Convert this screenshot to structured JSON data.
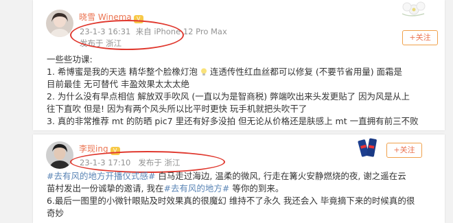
{
  "post1": {
    "username": "晓雪 Winema",
    "badge_icon": "vip-badge-icon",
    "date": "23-1-3 16:31",
    "device": "来自 iPhone 12 Pro Max",
    "location": "发布于 浙江",
    "follow_label": "+关注",
    "lines": [
      "一些些功课:",
      "1. 希博蜜是我的天选 精华整个脸橡灯泡",
      "连透传性红血丝都可以修复 (不要节省用量)  面霜是",
      "目前最佳 无可替代 丰盈效果太太太绝",
      "2. 为什么没有早点相信 解放双手吹风 (一直以为是智商税) 弊端吹出来头发更贴了 因为风是从上",
      "往下直吹 但是! 因为有两个风头所以比平时更快 玩手机就把头吹干了",
      "3. 真的非常推荐 mt 的防晒 pic7 里还有好多没拍 但无论从价格还是肤感上 mt 一直拥有前三不败"
    ]
  },
  "post2": {
    "username": "李现ing",
    "date": "23-1-3 17:10",
    "location": "发布于 浙江",
    "follow_label": "+关注",
    "hashtag1": "#去有风的地方开播仪式感#",
    "line1_rest": " 白马走过海边, 温柔的微风, 行走在篝火安静燃烧的夜, 谢之遥在云",
    "line2": "苗村发出一份诚挚的邀请, 我在",
    "hashtag2": "#去有风的地方#",
    "line2_rest": " 等你的到来。",
    "line3": "6.最后一图里的小微针眼贴及时效果真的很魔幻 维持不了永久 我还会入 毕竟摘下来的时候真的很",
    "line4": "奇妙"
  },
  "colors": {
    "username": "#eb7350",
    "meta": "#939393",
    "highlight_circle": "#e0382e",
    "hashtag": "#5a84b5"
  }
}
